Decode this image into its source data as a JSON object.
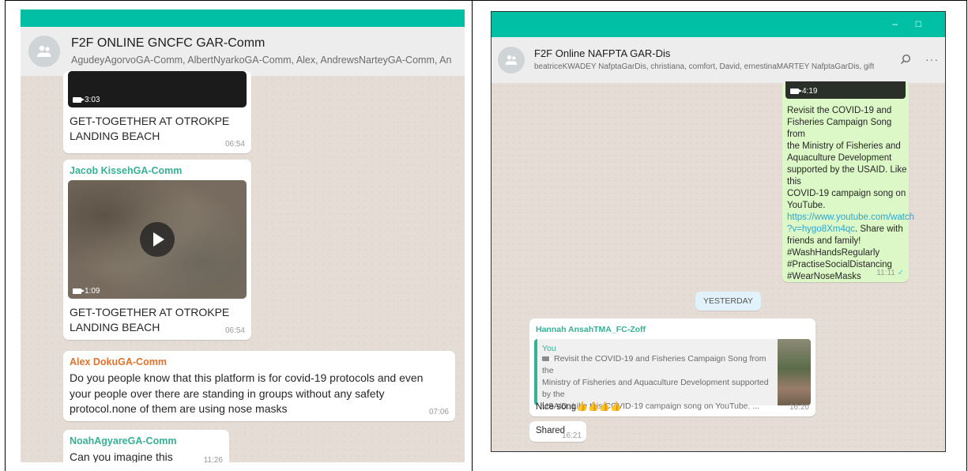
{
  "left": {
    "title": "F2F ONLINE GNCFC GAR-Comm",
    "participants": "AgudeyAgorvoGA-Comm, AlbertNyarkoGA-Comm, Alex, AndrewsNarteyGA-Comm, An",
    "messages": [
      {
        "duration": "3:03",
        "caption_1": "GET-TOGETHER AT OTROKPE",
        "caption_2": "LANDING BEACH",
        "time": "06:54"
      },
      {
        "sender": "Jacob KissehGA-Comm",
        "duration": "1:09",
        "caption_1": "GET-TOGETHER AT OTROKPE",
        "caption_2": "LANDING BEACH",
        "time": "06:54"
      },
      {
        "sender": "Alex DokuGA-Comm",
        "line_1": "Do you people know that this platform is for covid-19 protocols and even",
        "line_2": "your people over there are standing in groups without any safety",
        "line_3": "protocol.none of them are using nose masks",
        "time": "07:06"
      },
      {
        "sender": "NoahAgyareGA-Comm",
        "text": "Can you imagine this",
        "time": "11:26"
      }
    ]
  },
  "right": {
    "window_controls": {
      "minimize": "–",
      "maximize": "□"
    },
    "title": "F2F Online NAFPTA GAR-Dis",
    "participants": "beatriceKWADEY NafptaGarDis, christiana, comfort, David, ernestinaMARTEY NafptaGarDis, gifty, gladysQUA...",
    "header_icons": {
      "search": "search-icon",
      "menu": "more-icon"
    },
    "outgoing": {
      "duration": "4:19",
      "lines": [
        "Revisit the COVID-19 and",
        "Fisheries Campaign Song from",
        "the Ministry of Fisheries and",
        "Aquaculture Development",
        "supported by the USAID. Like this",
        "COVID-19 campaign song on",
        "YouTube."
      ],
      "link_1": "https://www.youtube.com/watch",
      "link_2": "?v=hygo8Xm4qc",
      "after_link": ". Share with",
      "lines_after": [
        "friends and family!",
        "#WashHandsRegularly",
        "#PractiseSocialDistancing",
        "#WearNoseMasks"
      ],
      "time": "11:11"
    },
    "date_chip": "YESTERDAY",
    "reply": {
      "sender": "Hannah AnsahTMA_FC-Zoff",
      "quote_author": "You",
      "quote_line_1": "Revisit the COVID-19 and Fisheries Campaign Song from the",
      "quote_line_2": "Ministry of Fisheries and Aquaculture Development supported by the",
      "quote_line_3": "USAID. Like this COVID-19 campaign song on YouTube. ...",
      "text": "Nice song👍👍👍👍",
      "time": "16:20"
    },
    "shared": {
      "text": "Shared",
      "time": "16:21"
    }
  },
  "colors": {
    "header_teal": "#00bfa5",
    "chat_bg": "#e5ddd5",
    "outgoing_bubble": "#dcf8c6",
    "sender_green": "#35b195",
    "sender_orange": "#e0732c",
    "link": "#2ba5d6"
  }
}
